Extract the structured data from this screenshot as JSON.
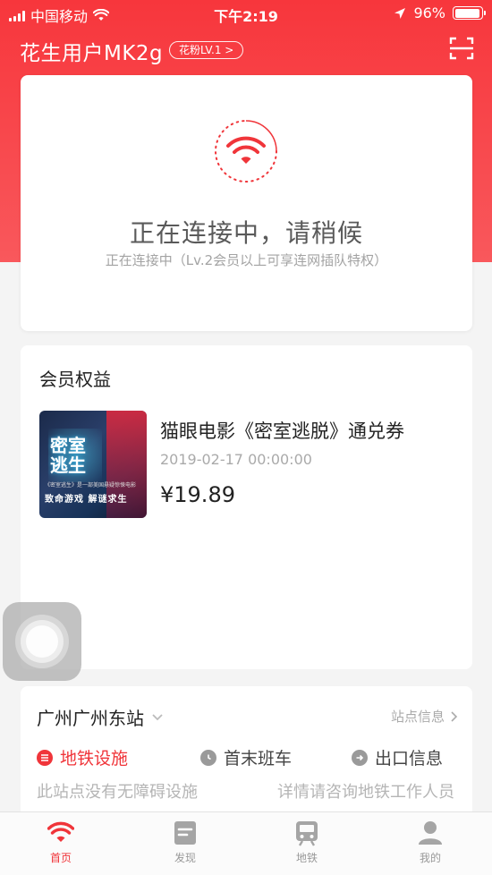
{
  "status_bar": {
    "carrier": "中国移动",
    "time": "下午2:19",
    "battery_percent": "96%",
    "battery_level": 0.96
  },
  "header": {
    "username": "花生用户MK2g",
    "level_badge": "花粉LV.1 >",
    "scan_icon": "scan-icon"
  },
  "connect": {
    "title": "正在连接中，请稍候",
    "subtitle": "正在连接中（Lv.2会员以上可享连网插队特权）",
    "icon": "wifi-icon",
    "accent": "#f0353a"
  },
  "benefits": {
    "heading": "会员权益",
    "items": [
      {
        "poster_title": "密室逃生",
        "poster_line": "《密室逃生》是一部美国悬疑惊悚电影",
        "poster_tag": "致命游戏 解谜求生",
        "name": "猫眼电影《密室逃脱》通兑券",
        "date": "2019-02-17 00:00:00",
        "price": "¥19.89"
      }
    ]
  },
  "station": {
    "name": "广州广州东站",
    "info_link": "站点信息",
    "tabs": [
      {
        "label": "地铁设施",
        "icon": "list-icon",
        "active": true
      },
      {
        "label": "首末班车",
        "icon": "clock-icon",
        "active": false
      },
      {
        "label": "出口信息",
        "icon": "exit-arrow-icon",
        "active": false
      }
    ],
    "note": "此站点没有无障碍设施",
    "contact": "详情请咨询地铁工作人员"
  },
  "tabbar": {
    "items": [
      {
        "label": "首页",
        "icon": "wifi-icon",
        "active": true
      },
      {
        "label": "发现",
        "icon": "discover-icon",
        "active": false
      },
      {
        "label": "地铁",
        "icon": "subway-icon",
        "active": false
      },
      {
        "label": "我的",
        "icon": "profile-icon",
        "active": false
      }
    ]
  },
  "colors": {
    "brand_red": "#f7363c",
    "active_red": "#f0353a",
    "inactive_gray": "#999999"
  }
}
